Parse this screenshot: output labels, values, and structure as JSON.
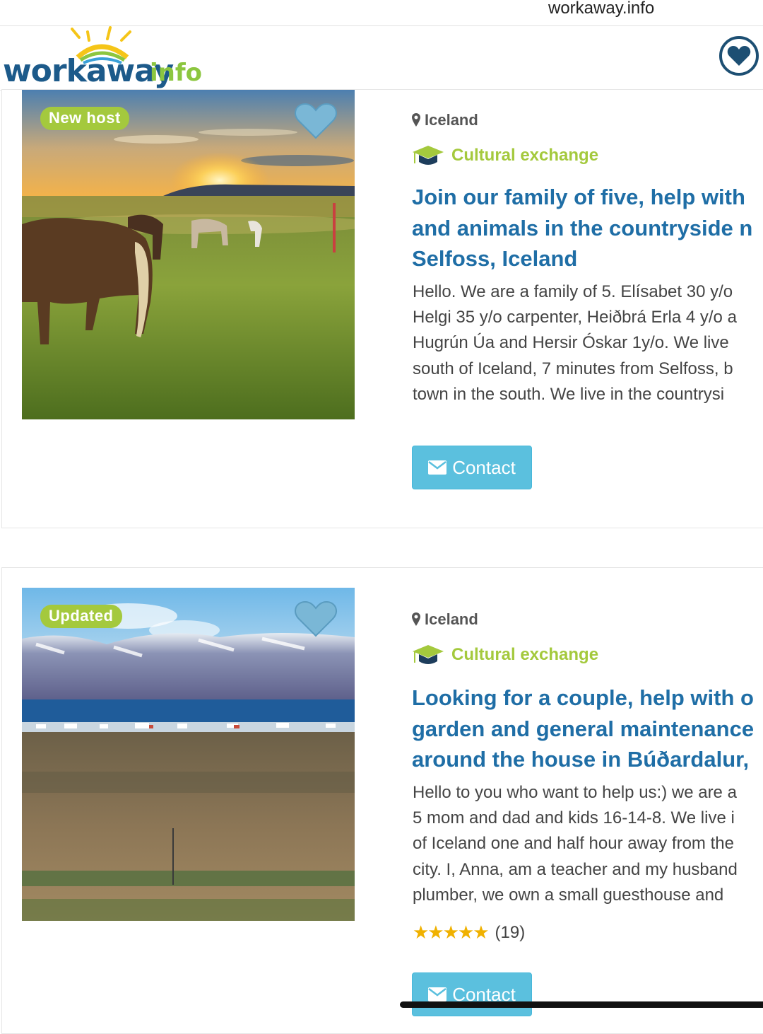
{
  "browser": {
    "url": "workaway.info"
  },
  "header": {
    "logo_main": "workaway",
    "logo_suffix": "info"
  },
  "listings": [
    {
      "badge": "New host",
      "location": "Iceland",
      "category": "Cultural exchange",
      "title_lines": [
        "Join our family of five, help with",
        "and animals in the countryside n",
        "Selfoss, Iceland"
      ],
      "desc_lines": [
        "Hello. We are a family of 5. Elísabet 30 y/o",
        "Helgi 35 y/o carpenter, Heiðbrá Erla 4 y/o a",
        "Hugrún Úa and Hersir Óskar 1y/o. We live",
        "south of Iceland, 7 minutes from Selfoss, b",
        "town in the south. We live in the countrysi"
      ],
      "contact_label": "Contact"
    },
    {
      "badge": "Updated",
      "location": "Iceland",
      "category": "Cultural exchange",
      "title_lines": [
        "Looking for a couple, help with o",
        "garden and general maintenance",
        "around the house in Búðardalur,"
      ],
      "desc_lines": [
        "Hello to you who want to help us:) we are a",
        "5 mom and dad and kids 16-14-8. We live i",
        "of Iceland one and half hour away from the",
        "city. I, Anna, am a teacher and my husband",
        "plumber, we own a small guesthouse and"
      ],
      "rating": {
        "stars": 5,
        "count": "(19)"
      },
      "contact_label": "Contact"
    }
  ],
  "colors": {
    "brand_blue": "#1f6ea6",
    "accent_green": "#a4c93d",
    "contact_blue": "#5bc0de"
  },
  "icons": {
    "favorite": "heart-icon",
    "location": "map-marker-icon",
    "category": "graduation-cap-icon",
    "contact": "envelope-icon"
  }
}
